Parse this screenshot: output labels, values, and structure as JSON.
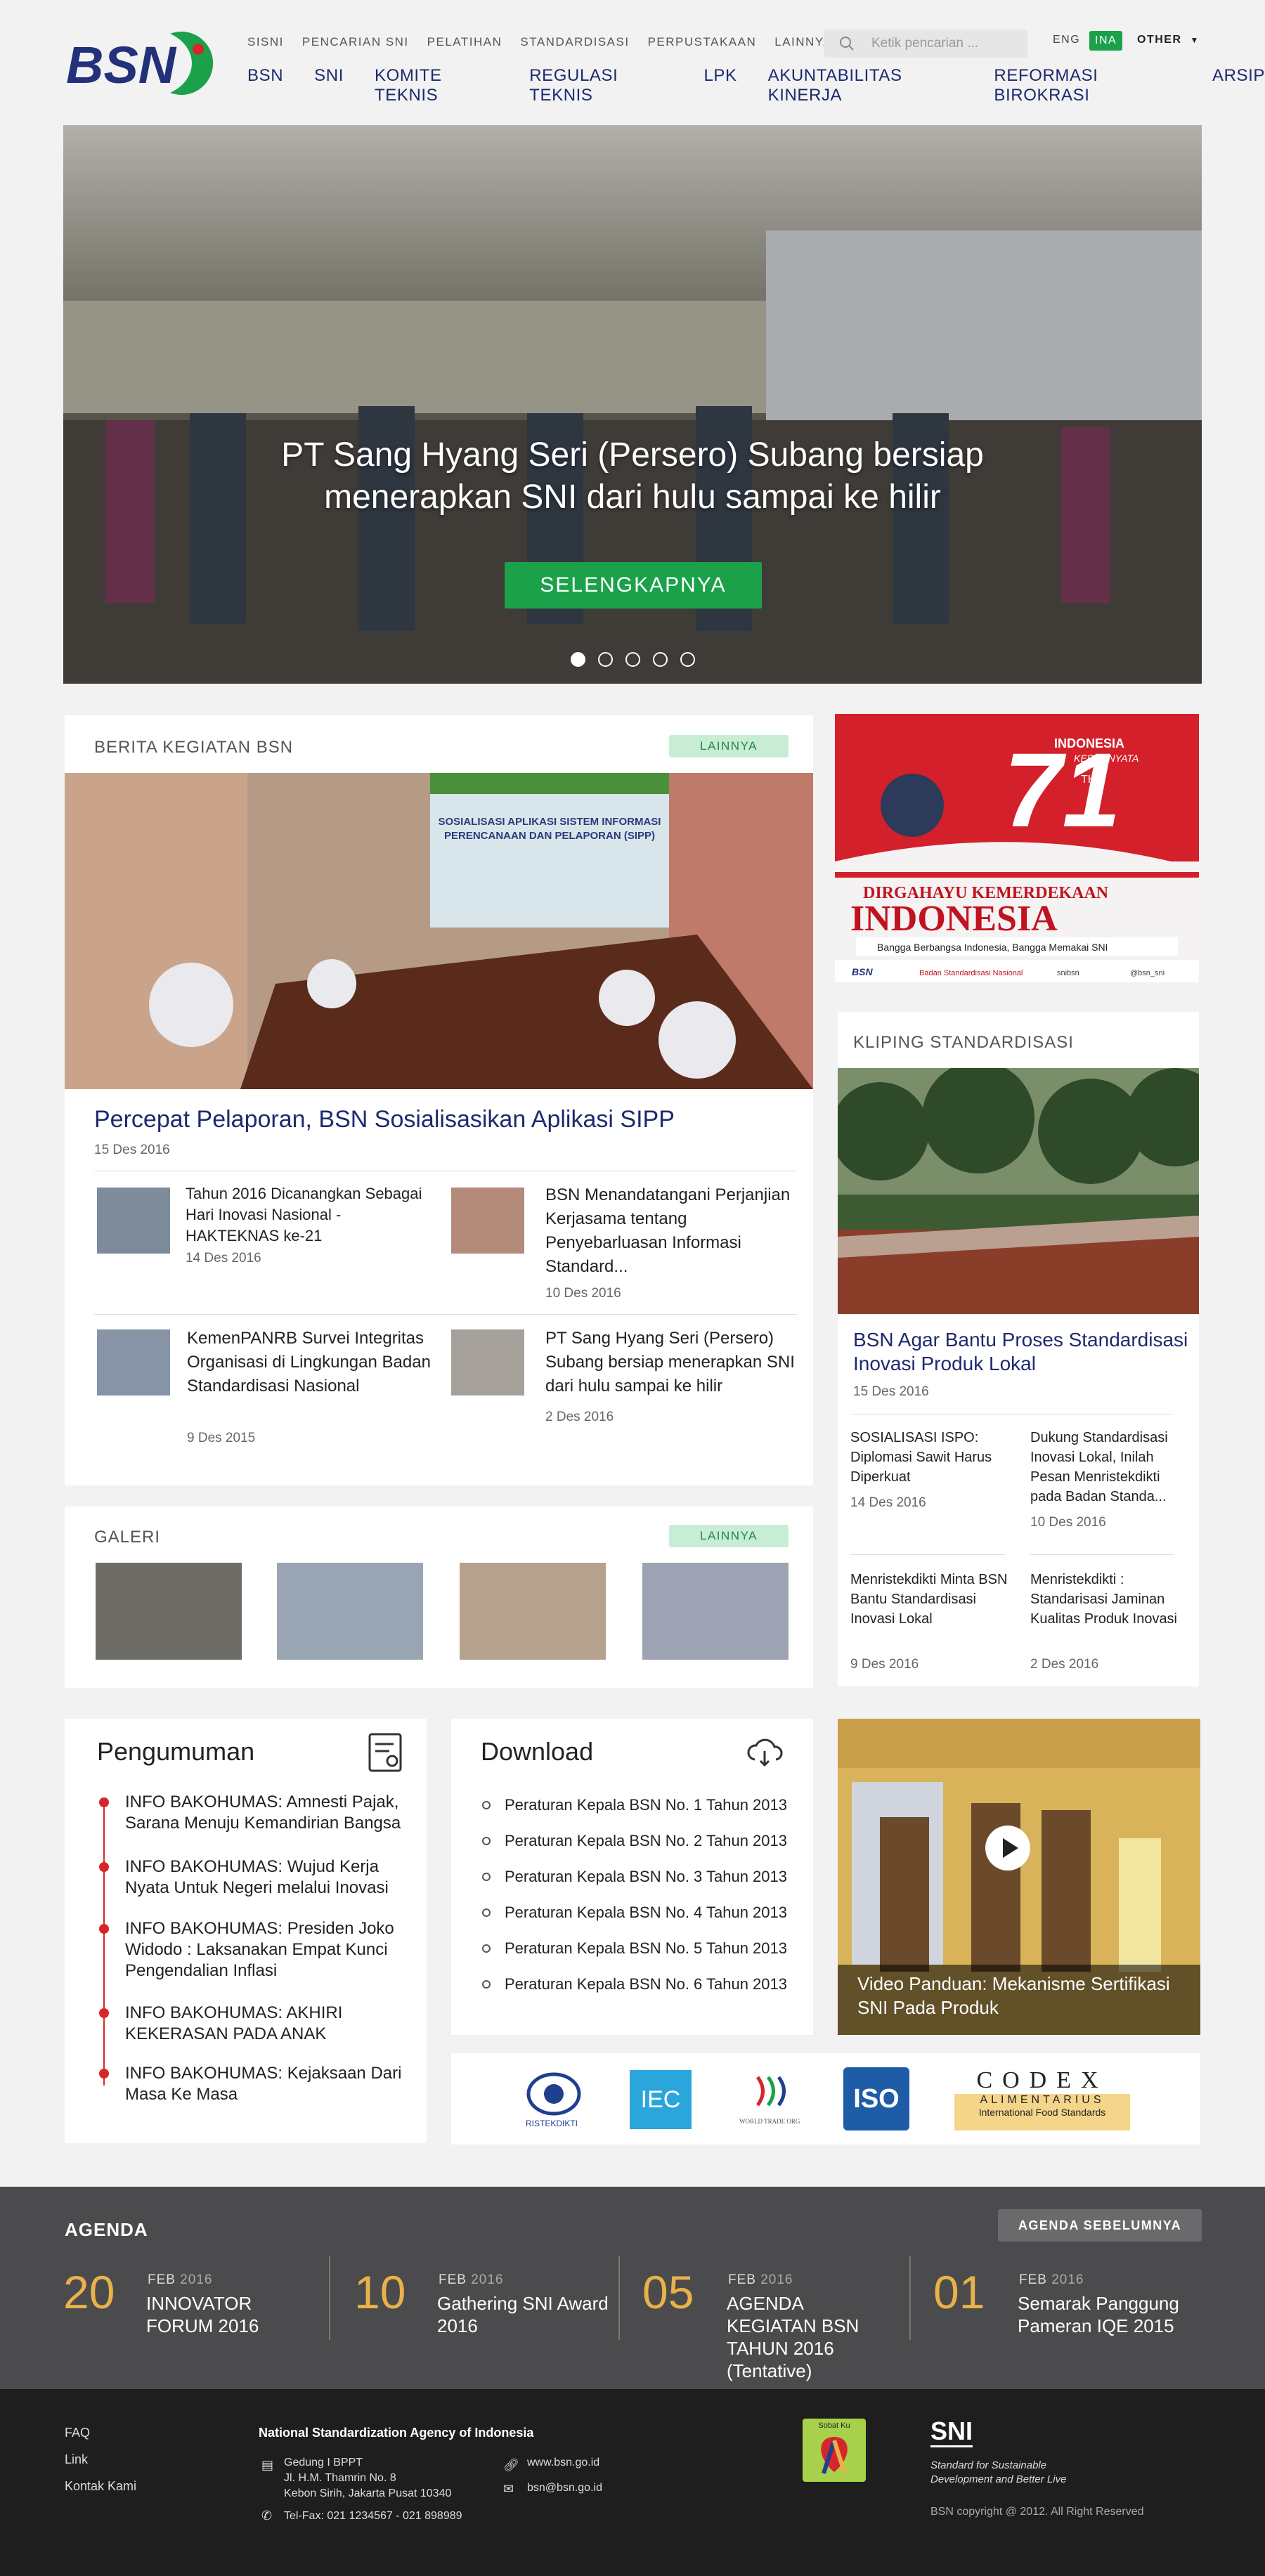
{
  "header": {
    "logo_text": "BSN",
    "top_nav": [
      "SISNI",
      "PENCARIAN SNI",
      "PELATIHAN",
      "STANDARDISASI",
      "PERPUSTAKAAN",
      "LAINNYA"
    ],
    "main_nav": [
      "BSN",
      "SNI",
      "KOMITE TEKNIS",
      "REGULASI TEKNIS",
      "LPK",
      "AKUNTABILITAS KINERJA",
      "REFORMASI BIROKRASI",
      "ARSIP"
    ],
    "search_placeholder": "Ketik pencarian ...",
    "lang_eng": "ENG",
    "lang_ina": "INA",
    "other": "OTHER"
  },
  "hero": {
    "caption_line1": "PT Sang Hyang Seri (Persero) Subang bersiap",
    "caption_line2": "menerapkan SNI dari hulu sampai ke hilir",
    "button": "SELENGKAPNYA",
    "slides_total": 5,
    "active_slide": 1
  },
  "news": {
    "title": "BERITA KEGIATAN BSN",
    "more": "LAINNYA",
    "slide_title": "SOSIALISASI APLIKASI SISTEM INFORMASI PERENCANAAN DAN PELAPORAN (SIPP)",
    "headline": "Percepat Pelaporan, BSN Sosialisasikan Aplikasi SIPP",
    "headline_date": "15 Des 2016",
    "items": [
      {
        "title": "Tahun 2016 Dicanangkan Sebagai Hari Inovasi Nasional - HAKTEKNAS ke-21",
        "date": "14 Des 2016"
      },
      {
        "title": "BSN Menandatangani Perjanjian Kerjasama tentang Penyebarluasan Informasi Standard...",
        "date": "10 Des 2016"
      },
      {
        "title": "KemenPANRB Survei Integritas Organisasi di Lingkungan Badan Standardisasi Nasional",
        "date": "9 Des 2015"
      },
      {
        "title": "PT Sang Hyang Seri (Persero) Subang bersiap menerapkan SNI dari hulu sampai ke hilir",
        "date": "2 Des 2016"
      }
    ]
  },
  "banner": {
    "line1": "INDONESIA",
    "line2": "KERJA NYATA",
    "number": "71",
    "sub": "TH",
    "title1": "DIRGAHAYU KEMERDEKAAN",
    "title2": "INDONESIA",
    "tagline": "Bangga Berbangsa Indonesia, Bangga Memakai SNI",
    "org": "Badan Standardisasi Nasional",
    "social1": "snibsn",
    "social2": "@bsn_sni"
  },
  "gallery": {
    "title": "GALERI",
    "more": "LAINNYA"
  },
  "kliping": {
    "title": "KLIPING STANDARDISASI",
    "headline": "BSN Agar Bantu Proses Standardisasi Inovasi Produk Lokal",
    "headline_date": "15 Des 2016",
    "items": [
      {
        "title": "SOSIALISASI ISPO: Diplomasi Sawit Harus Diperkuat",
        "date": "14 Des 2016"
      },
      {
        "title": "Dukung Standardisasi Inovasi Lokal, Inilah Pesan Menristekdikti pada Badan Standa...",
        "date": "10 Des 2016"
      },
      {
        "title": "Menristekdikti Minta BSN Bantu Standardisasi Inovasi Lokal",
        "date": "9 Des 2016"
      },
      {
        "title": "Menristekdikti : Standarisasi Jaminan Kualitas Produk Inovasi",
        "date": "2 Des 2016"
      }
    ]
  },
  "pengumuman": {
    "title": "Pengumuman",
    "items": [
      "INFO BAKOHUMAS: Amnesti Pajak, Sarana Menuju Kemandirian Bangsa",
      "INFO BAKOHUMAS: Wujud Kerja Nyata Untuk Negeri melalui Inovasi",
      "INFO BAKOHUMAS: Presiden Joko Widodo : Laksanakan Empat Kunci Pengendalian Inflasi",
      "INFO BAKOHUMAS: AKHIRI KEKERASAN PADA ANAK",
      "INFO BAKOHUMAS: Kejaksaan Dari Masa Ke Masa"
    ]
  },
  "download": {
    "title": "Download",
    "items": [
      "Peraturan Kepala BSN No. 1 Tahun 2013",
      "Peraturan Kepala BSN No. 2 Tahun 2013",
      "Peraturan Kepala BSN No. 3 Tahun 2013",
      "Peraturan Kepala BSN No. 4 Tahun 2013",
      "Peraturan Kepala BSN No. 5 Tahun 2013",
      "Peraturan Kepala BSN No. 6 Tahun 2013"
    ]
  },
  "video": {
    "title": "Video Panduan: Mekanisme Sertifikasi SNI Pada Produk"
  },
  "partners": {
    "ristekdikti": "RISTEKDIKTI",
    "iec": "IEC",
    "wto": "WORLD TRADE ORGANIZATION",
    "iso": "ISO",
    "codex1": "CODEX",
    "codex2": "ALIMENTARIUS",
    "codex3": "International Food Standards"
  },
  "agenda": {
    "title": "AGENDA",
    "prev": "AGENDA SEBELUMNYA",
    "items": [
      {
        "day": "20",
        "month": "FEB",
        "year": "2016",
        "title": "INNOVATOR FORUM 2016"
      },
      {
        "day": "10",
        "month": "FEB",
        "year": "2016",
        "title": "Gathering SNI Award 2016"
      },
      {
        "day": "05",
        "month": "FEB",
        "year": "2016",
        "title": "AGENDA KEGIATAN BSN TAHUN 2016 (Tentative)"
      },
      {
        "day": "01",
        "month": "FEB",
        "year": "2016",
        "title": "Semarak Panggung Pameran IQE 2015"
      }
    ]
  },
  "footer": {
    "links": [
      "FAQ",
      "Link",
      "Kontak Kami"
    ],
    "org": "National Standardization Agency of Indonesia",
    "address1": "Gedung I BPPT",
    "address2": "Jl. H.M. Thamrin No. 8",
    "address3": "Kebon Sirih, Jakarta Pusat 10340",
    "telfax": "Tel-Fax: 021 1234567 - 021 898989",
    "web": "www.bsn.go.id",
    "email": "bsn@bsn.go.id",
    "badge": "Sobat Ku",
    "sni_logo": "SNI",
    "sni_tag1": "Standard for Sustainable",
    "sni_tag2": "Development and Better Live",
    "copyright": "BSN copyright @ 2012. All Right Reserved"
  }
}
